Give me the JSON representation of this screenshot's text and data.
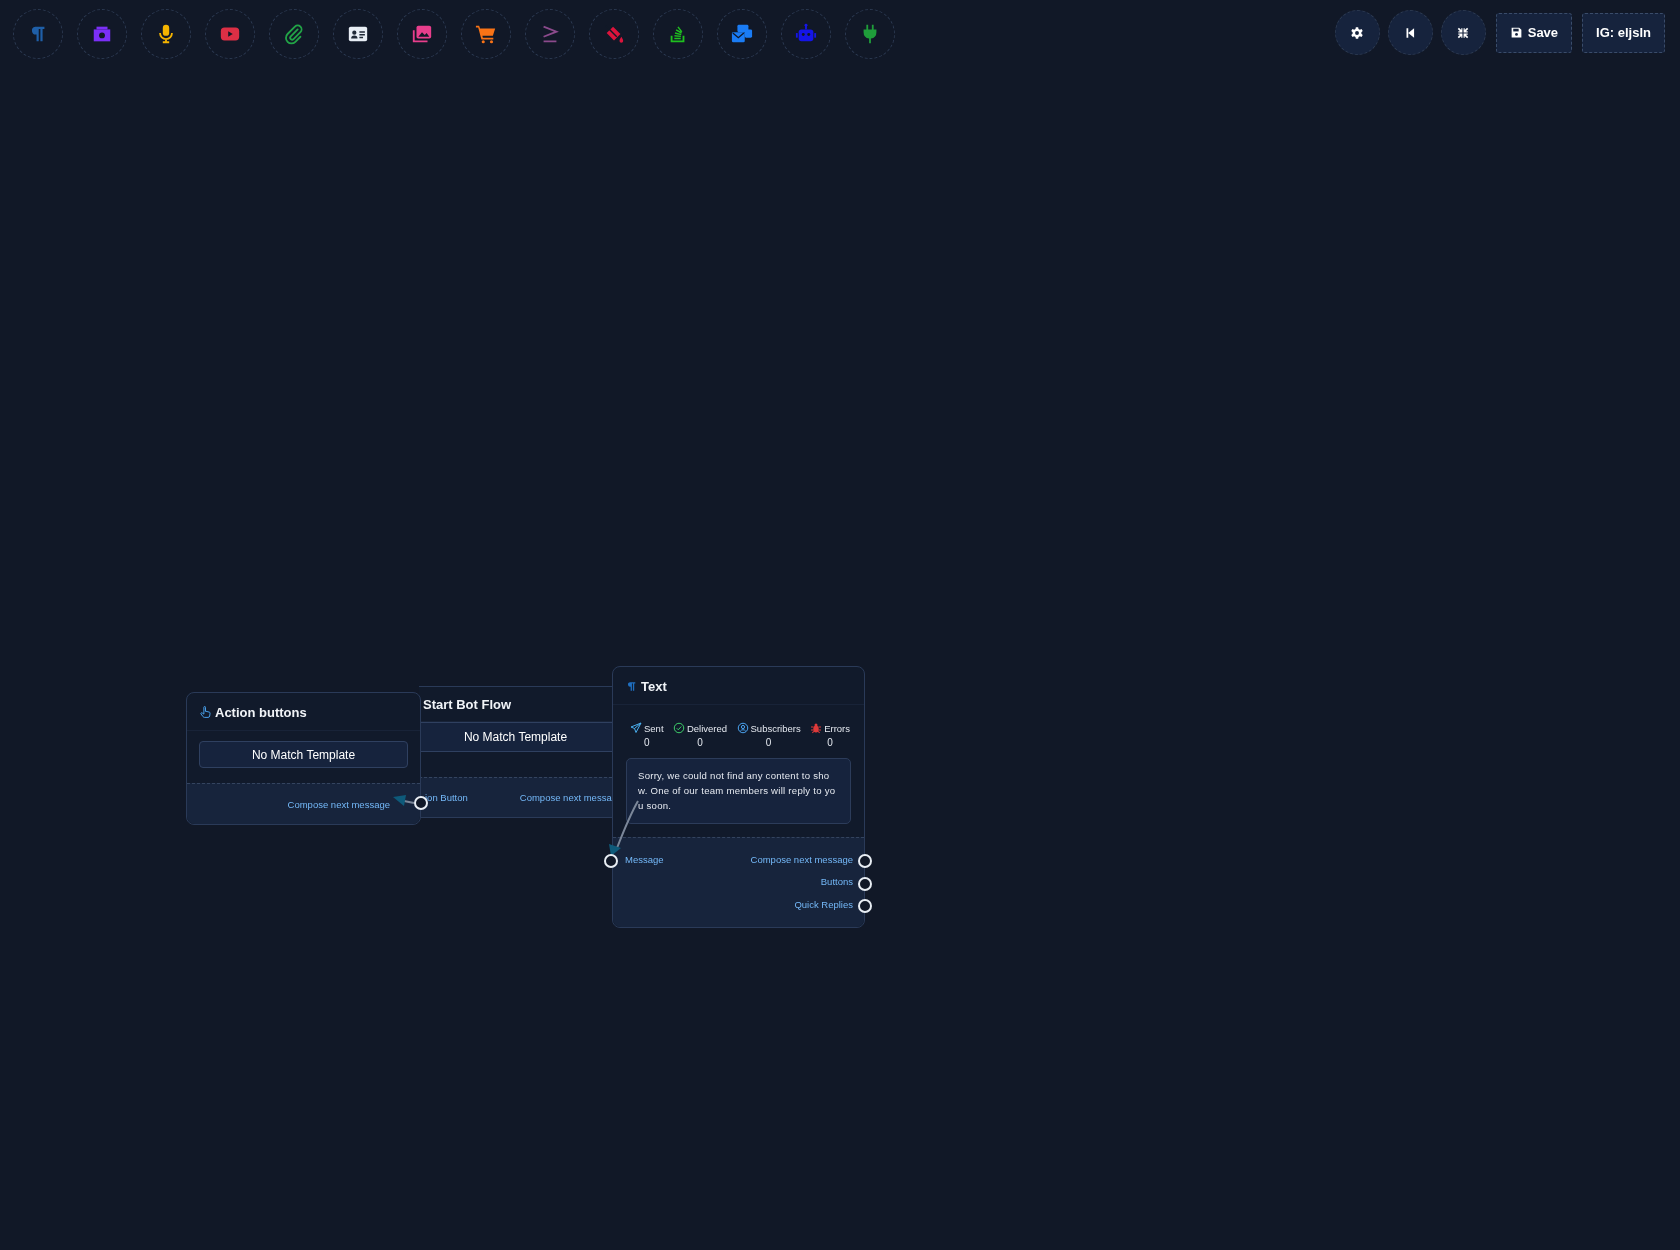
{
  "toolbar": {
    "tools": [
      {
        "kind": "paragraph"
      },
      {
        "kind": "camera"
      },
      {
        "kind": "microphone"
      },
      {
        "kind": "video"
      },
      {
        "kind": "paperclip"
      },
      {
        "kind": "id-card"
      },
      {
        "kind": "images"
      },
      {
        "kind": "cart"
      },
      {
        "kind": "greater-equal"
      },
      {
        "kind": "paint-bucket"
      },
      {
        "kind": "stack"
      },
      {
        "kind": "mail"
      },
      {
        "kind": "robot"
      },
      {
        "kind": "plug"
      }
    ]
  },
  "top_right": {
    "icon_buttons": [
      {
        "kind": "settings"
      },
      {
        "kind": "first"
      },
      {
        "kind": "collapse"
      }
    ],
    "save_button": "Save",
    "account_button": "IG: eljsln"
  },
  "nodes": [
    {
      "kind": "start_bot_flow",
      "title": "Start Bot Flow",
      "template_button": "No Match Template",
      "outputs": [
        "ion Button",
        "Compose next messa"
      ]
    },
    {
      "kind": "action_buttons",
      "title": "Action buttons",
      "template_button": "No Match Template",
      "outputs": [
        "Compose next message"
      ]
    },
    {
      "kind": "text",
      "title": "Text",
      "stats": [
        {
          "kind": "sent",
          "label": "Sent",
          "value": "0"
        },
        {
          "kind": "delivered",
          "label": "Delivered",
          "value": "0"
        },
        {
          "kind": "subscribers",
          "label": "Subscribers",
          "value": "0"
        },
        {
          "kind": "errors",
          "label": "Errors",
          "value": "0"
        }
      ],
      "message": "Sorry, we could not find any content to show. One of our team members will reply to you soon.",
      "input": "Message",
      "outputs": [
        "Compose next message",
        "Buttons",
        "Quick Replies"
      ]
    }
  ]
}
